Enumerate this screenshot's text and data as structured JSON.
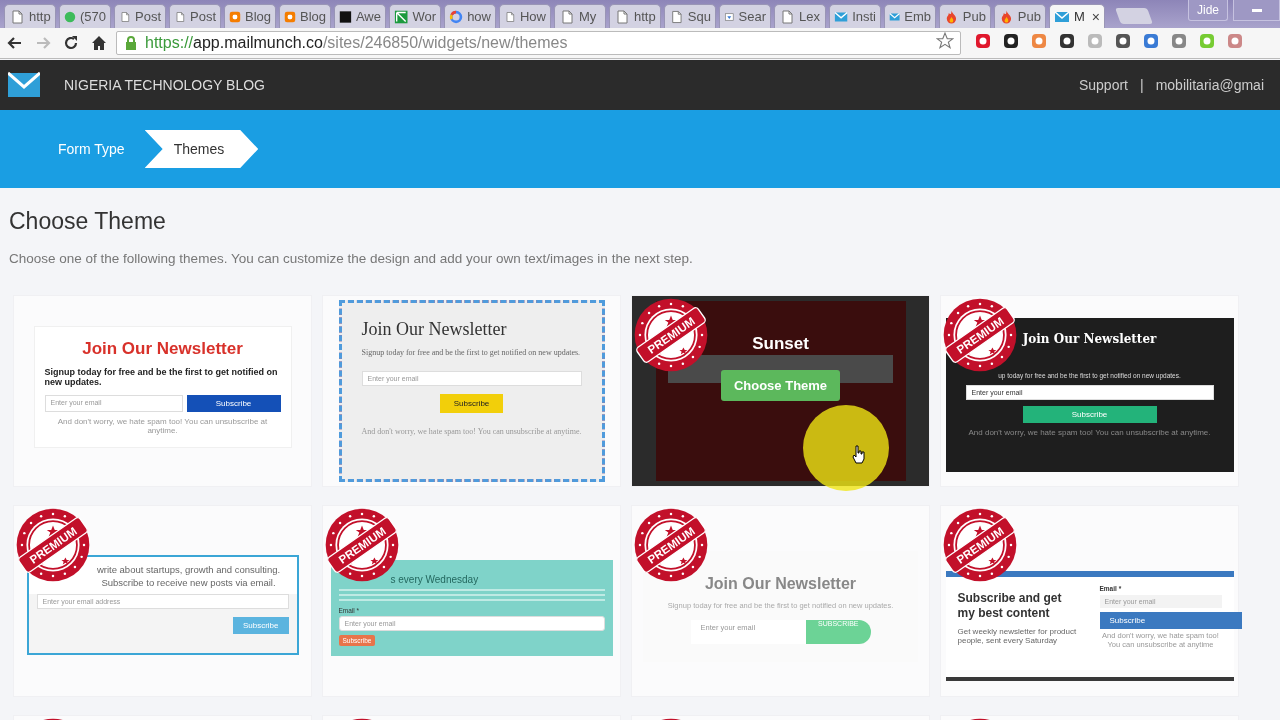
{
  "browser": {
    "tabs": [
      {
        "label": "http",
        "kind": "page",
        "selected": false
      },
      {
        "label": "(570",
        "kind": "badge",
        "selected": false
      },
      {
        "label": "Post",
        "kind": "page",
        "selected": false
      },
      {
        "label": "Post",
        "kind": "page",
        "selected": false
      },
      {
        "label": "Blog",
        "kind": "blogger",
        "selected": false
      },
      {
        "label": "Blog",
        "kind": "blogger",
        "selected": false
      },
      {
        "label": "Awe",
        "kind": "ob",
        "selected": false
      },
      {
        "label": "Wor",
        "kind": "sheet",
        "selected": false
      },
      {
        "label": "how",
        "kind": "google",
        "selected": false
      },
      {
        "label": "How",
        "kind": "page",
        "selected": false
      },
      {
        "label": "My",
        "kind": "page",
        "selected": false
      },
      {
        "label": "http",
        "kind": "page",
        "selected": false
      },
      {
        "label": "Squ",
        "kind": "page",
        "selected": false
      },
      {
        "label": "Sear",
        "kind": "search",
        "selected": false
      },
      {
        "label": "Lex",
        "kind": "page",
        "selected": false
      },
      {
        "label": "Insti",
        "kind": "mailmunch",
        "selected": false
      },
      {
        "label": "Emb",
        "kind": "mailmunch",
        "selected": false
      },
      {
        "label": "Pub",
        "kind": "fire",
        "selected": false
      },
      {
        "label": "Pub",
        "kind": "fire",
        "selected": false
      },
      {
        "label": "M",
        "kind": "mailmunch",
        "selected": true
      }
    ],
    "close_tab": "×",
    "profile": "Jide",
    "forward": {
      "disabled": true
    },
    "url": {
      "scheme": "https://",
      "host": "app.mailmunch.co",
      "path": "/sites/246850/widgets/new/themes"
    }
  },
  "header": {
    "site": "NIGERIA TECHNOLOGY BLOG",
    "support": "Support",
    "separator": "|",
    "account": "mobilitaria@gmai"
  },
  "steps": [
    {
      "label": "Form Type",
      "selected": false
    },
    {
      "label": "Themes",
      "selected": true
    }
  ],
  "page": {
    "title": "Choose Theme",
    "description": "Choose one of the following themes. You can customize the design and add your own text/images in the next step."
  },
  "themes": [
    {
      "kind": "classic",
      "stamp": false,
      "hovered": false,
      "title": "Join Our Newsletter",
      "text": "Signup today for free and be the first to get notified on new updates.",
      "placeholder": "Enter your email",
      "button": "Subscribe",
      "note": "And don't worry, we hate spam too! You can unsubscribe at anytime."
    },
    {
      "kind": "airmail",
      "stamp": false,
      "hovered": false,
      "title": "Join Our Newsletter",
      "text": "Signup today for free and be the first to get notified on new updates.",
      "placeholder": "Enter your email",
      "button": "Subscribe",
      "note": "And don't worry, we hate spam too! You can unsubscribe at anytime."
    },
    {
      "kind": "sunset",
      "stamp": true,
      "badge": "PREMIUM",
      "hovered": true,
      "name": "Sunset",
      "action": "Choose Theme"
    },
    {
      "kind": "dark",
      "stamp": true,
      "badge": "PREMIUM",
      "hovered": false,
      "title": "Join Our Newsletter",
      "text": "up today for free and be the first to get notified on new updates.",
      "placeholder": "Enter your email",
      "button": "Subscribe",
      "note": "And don't worry, we hate spam too! You can unsubscribe at anytime."
    },
    {
      "kind": "bordered",
      "stamp": true,
      "badge": "PREMIUM",
      "hovered": false,
      "text": "write about startups, growth and consulting. Subscribe to receive new posts via email.",
      "placeholder": "Enter your email address",
      "button": "Subscribe"
    },
    {
      "kind": "teal",
      "stamp": true,
      "badge": "PREMIUM",
      "hovered": false,
      "title": "s every Wednesday",
      "label": "Email *",
      "placeholder": "Enter your email",
      "button": "Subscribe"
    },
    {
      "kind": "minimal",
      "stamp": true,
      "badge": "PREMIUM",
      "hovered": false,
      "title": "Join Our Newsletter",
      "text": "Signup today for free and be the first to get notified on new updates.",
      "placeholder": "Enter your email",
      "button": "SUBSCRIBE"
    },
    {
      "kind": "split",
      "stamp": true,
      "badge": "PREMIUM",
      "hovered": false,
      "title": "Subscribe and get my best content",
      "text": "Get weekly newsletter for product people, sent every Saturday",
      "label": "Email *",
      "placeholder": "Enter your email",
      "button": "Subscribe",
      "note": "And don't worry, we hate spam too! You can unsubscribe at anytime"
    },
    {
      "kind": "blank",
      "stamp": true,
      "hovered": false
    },
    {
      "kind": "blank",
      "stamp": true,
      "hovered": false
    },
    {
      "kind": "blank",
      "stamp": true,
      "hovered": false
    },
    {
      "kind": "blank",
      "stamp": true,
      "hovered": false
    }
  ]
}
